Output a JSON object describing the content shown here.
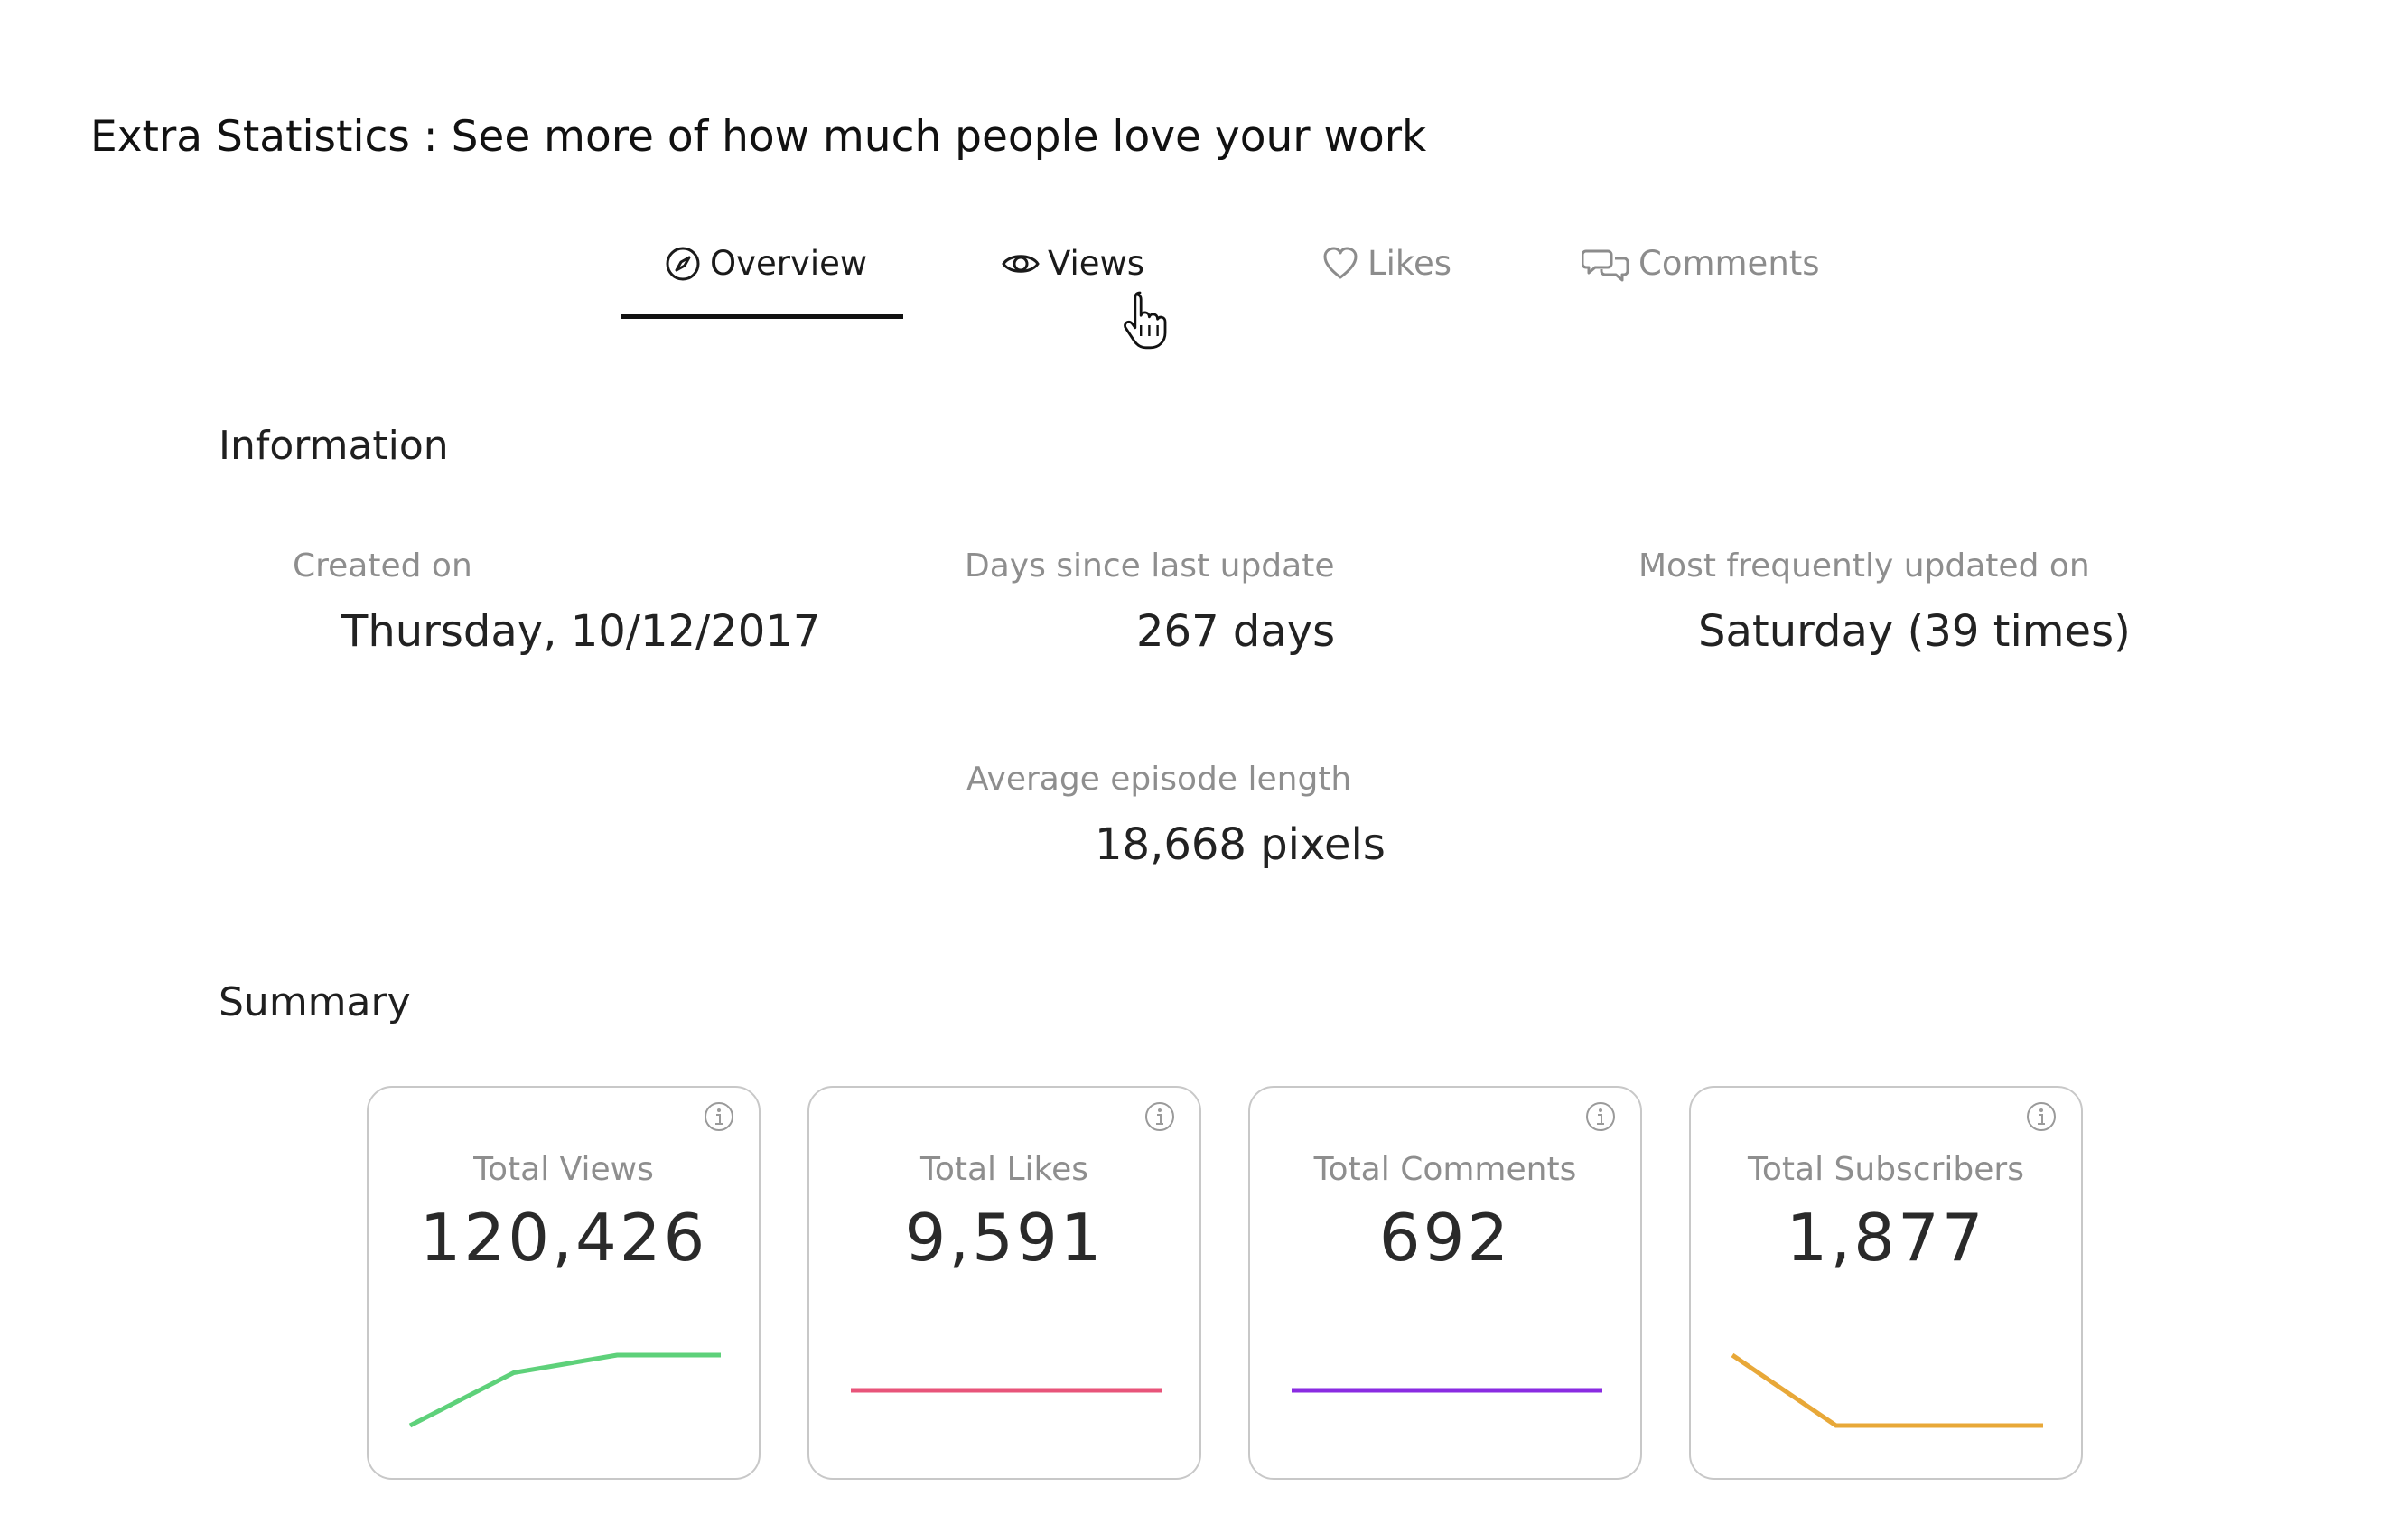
{
  "header": {
    "title": "Extra Statistics : See more of how much people love your work"
  },
  "tabs": [
    {
      "label": "Overview",
      "icon": "compass-icon",
      "state": "active"
    },
    {
      "label": "Views",
      "icon": "eye-icon",
      "state": "hover"
    },
    {
      "label": "Likes",
      "icon": "heart-icon",
      "state": "inactive"
    },
    {
      "label": "Comments",
      "icon": "chat-bubbles-icon",
      "state": "inactive"
    }
  ],
  "information": {
    "title": "Information",
    "created_on": {
      "label": "Created on",
      "value": "Thursday, 10/12/2017"
    },
    "days_since_update": {
      "label": "Days since last update",
      "value": "267 days"
    },
    "most_frequent": {
      "label": "Most frequently updated on",
      "value": "Saturday (39 times)"
    },
    "avg_episode_length": {
      "label": "Average episode length",
      "value": "18,668 pixels"
    }
  },
  "summary": {
    "title": "Summary",
    "cards": [
      {
        "label": "Total Views",
        "value": "120,426",
        "color": "#5ed17a",
        "trend": [
          0,
          0.75,
          1,
          1
        ]
      },
      {
        "label": "Total Likes",
        "value": "9,591",
        "color": "#e8547a",
        "trend": [
          0.5,
          0.5,
          0.5,
          0.5
        ]
      },
      {
        "label": "Total Comments",
        "value": "692",
        "color": "#8a2be2",
        "trend": [
          0.5,
          0.5,
          0.5,
          0.5
        ]
      },
      {
        "label": "Total Subscribers",
        "value": "1,877",
        "color": "#e8a838",
        "trend": [
          1,
          0,
          0,
          0
        ]
      }
    ]
  },
  "colors": {
    "accent": "#111111",
    "muted_text": "#8e8e8e",
    "card_border": "#c8c8c8"
  }
}
